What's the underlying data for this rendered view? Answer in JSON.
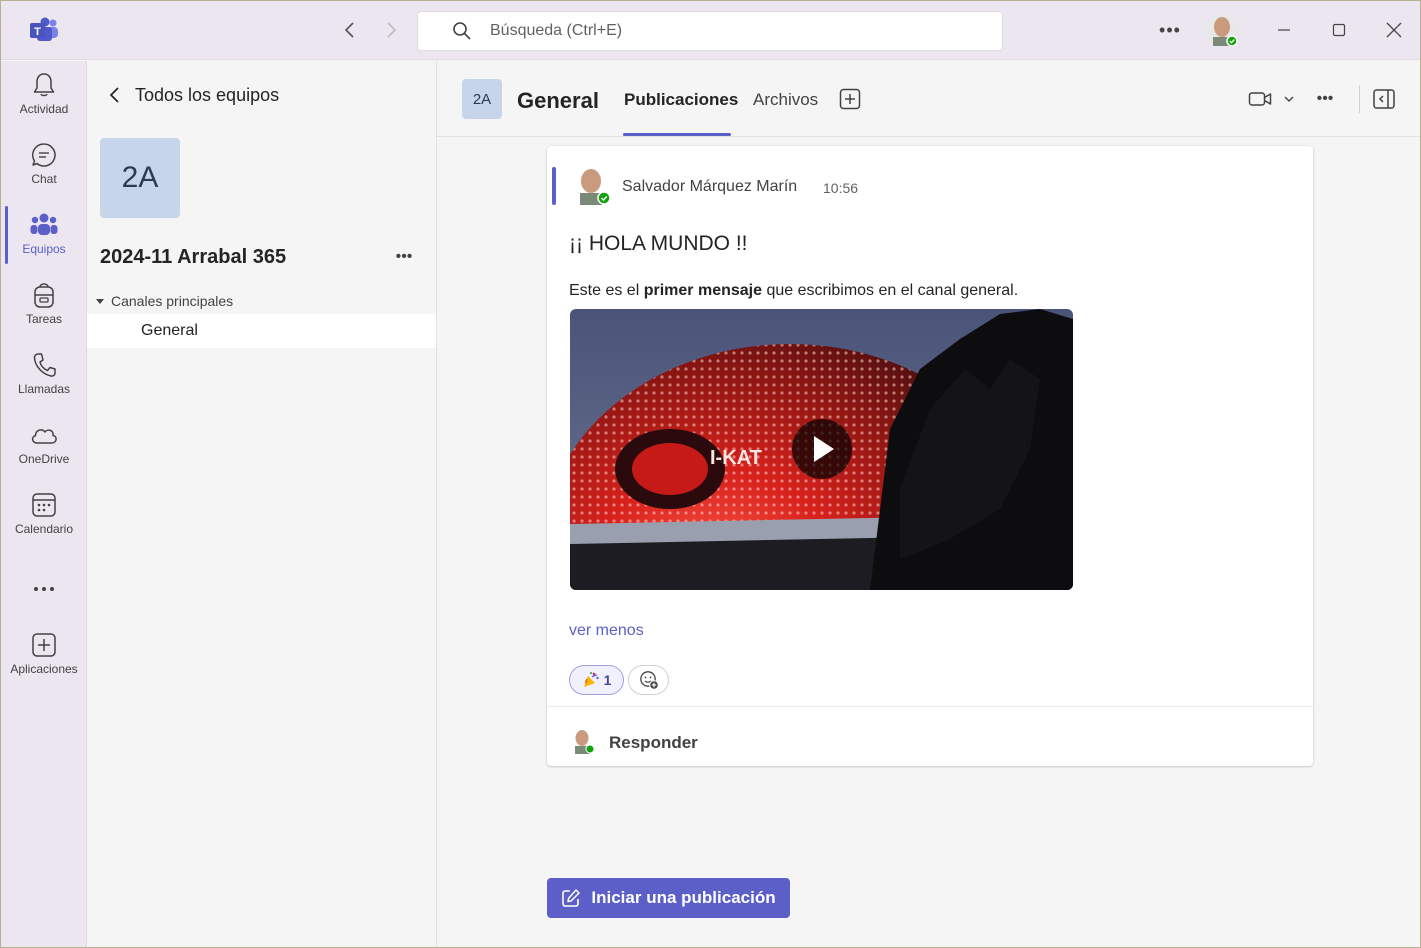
{
  "search": {
    "placeholder": "Búsqueda (Ctrl+E)"
  },
  "rail": {
    "items": [
      {
        "label": "Actividad",
        "icon": "bell-icon"
      },
      {
        "label": "Chat",
        "icon": "chat-icon"
      },
      {
        "label": "Equipos",
        "icon": "teams-icon"
      },
      {
        "label": "Tareas",
        "icon": "backpack-icon"
      },
      {
        "label": "Llamadas",
        "icon": "phone-icon"
      },
      {
        "label": "OneDrive",
        "icon": "cloud-icon"
      },
      {
        "label": "Calendario",
        "icon": "calendar-icon"
      },
      {
        "label": "Aplicaciones",
        "icon": "add-app-icon"
      }
    ],
    "active": "Equipos"
  },
  "teampanel": {
    "back_label": "Todos los equipos",
    "team_initials": "2A",
    "team_name": "2024-11 Arrabal 365",
    "section_label": "Canales principales",
    "channel_label": "General"
  },
  "channel": {
    "initials": "2A",
    "title": "General",
    "tabs": [
      {
        "label": "Publicaciones",
        "active": true
      },
      {
        "label": "Archivos",
        "active": false
      }
    ]
  },
  "post": {
    "author": "Salvador Márquez Marín",
    "time": "10:56",
    "subject": "¡¡ HOLA MUNDO !!",
    "body_prefix": "Este es el",
    "body_bold": "primer mensaje",
    "body_suffix": "que escribimos en el canal general.",
    "see_less": "ver menos",
    "reaction_count": "1",
    "reaction_icon": "party-popper-icon",
    "reply_label": "Responder"
  },
  "new_post_label": "Iniciar una publicación",
  "colors": {
    "accent": "#5b5fc7",
    "presence": "#13a10e"
  }
}
